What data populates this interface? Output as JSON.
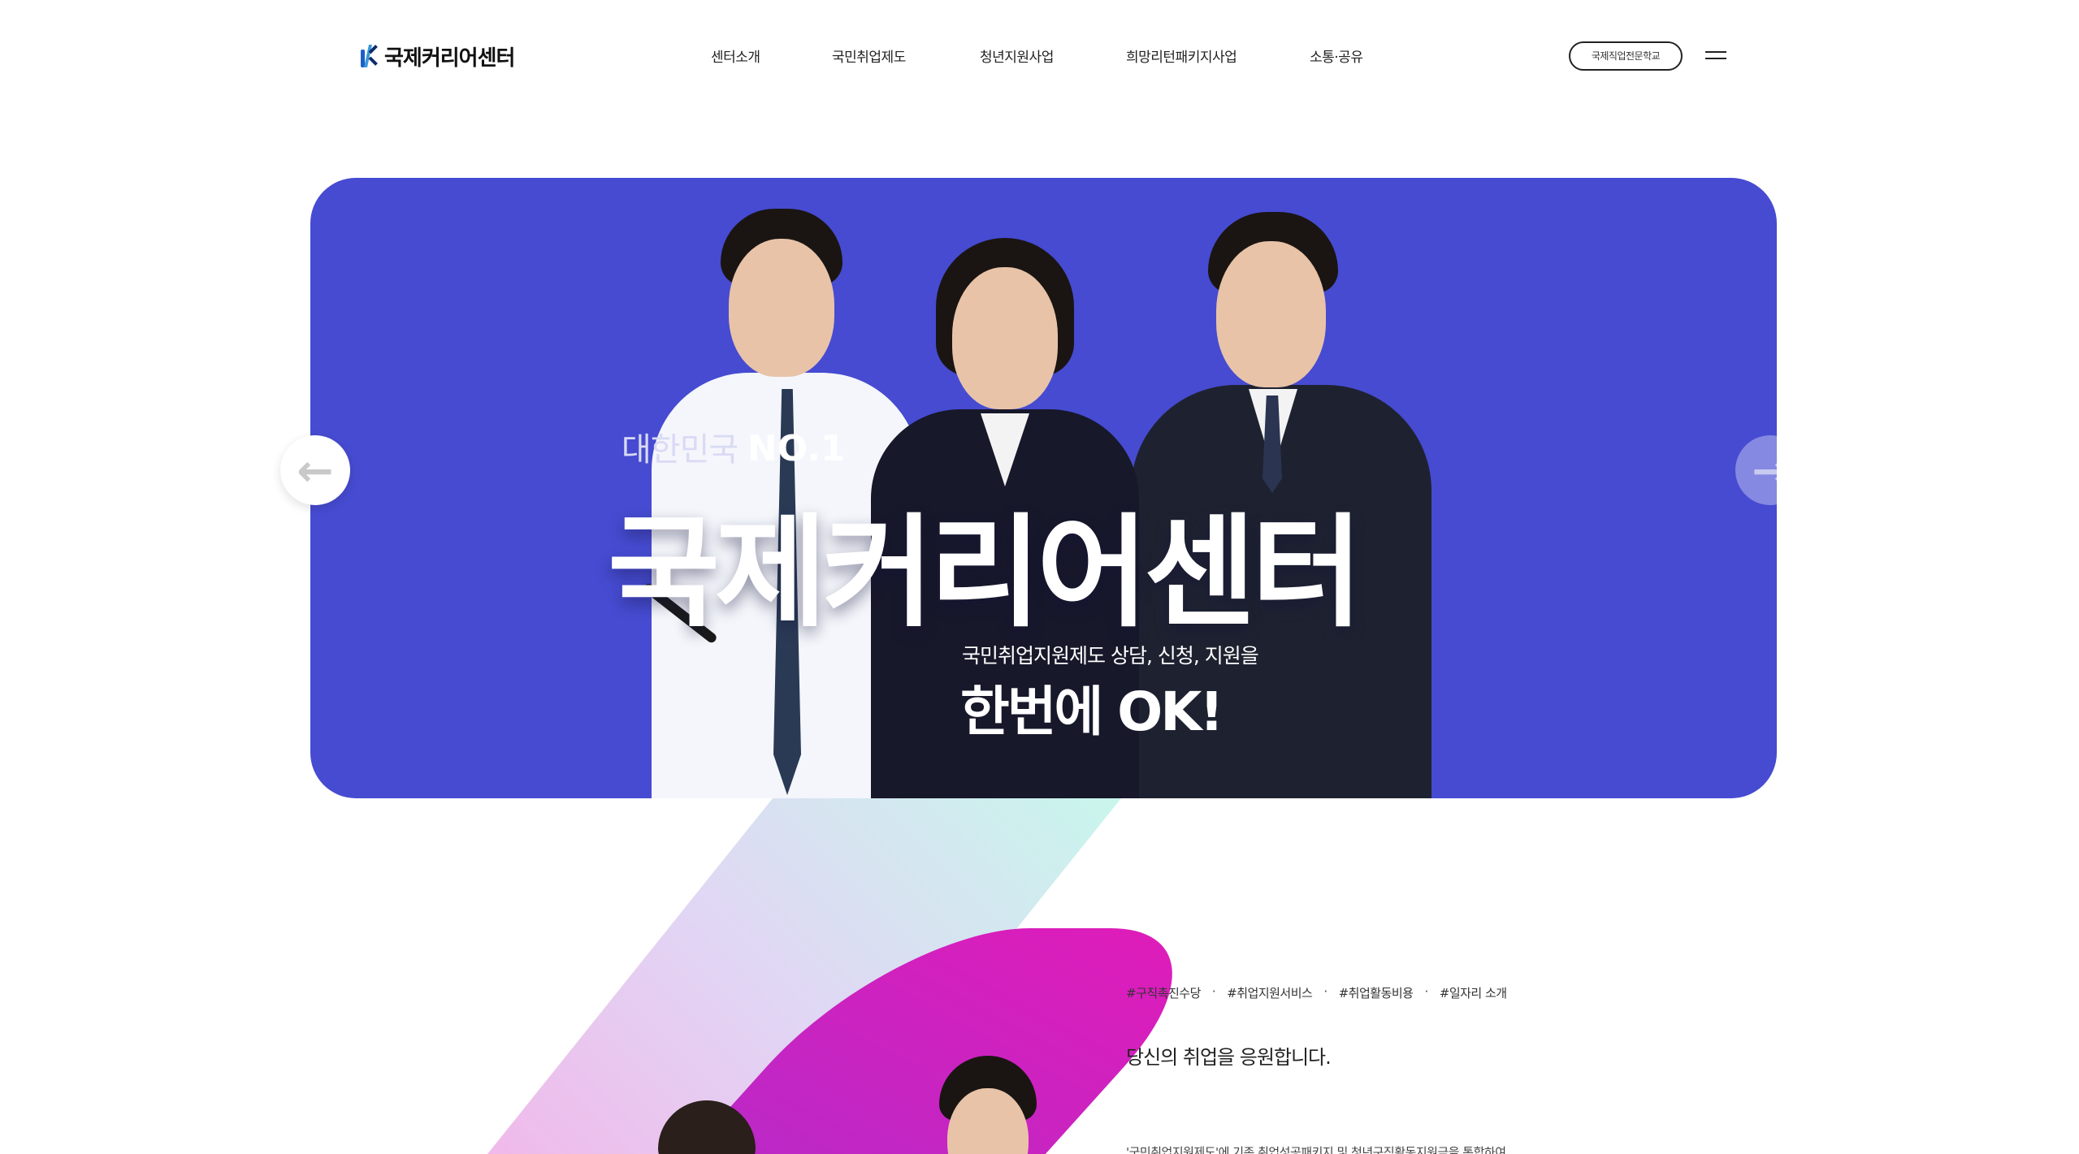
{
  "header": {
    "logo_text": "국제커리어센터",
    "nav": [
      "센터소개",
      "국민취업제도",
      "청년지원사업",
      "희망리턴패키지사업",
      "소통·공유"
    ],
    "school_button": "국제직업전문학교"
  },
  "hero": {
    "sub_prefix": "대한민국",
    "sub_badge": "NO.1",
    "title": "국제커리어센터",
    "desc": "국민취업지원제도 상담, 신청, 지원을",
    "ok": "한번에 OK!",
    "bg_color": "#464bd1",
    "prev_icon": "arrow-left-icon",
    "next_icon": "arrow-right-icon"
  },
  "section": {
    "tags": [
      "#구직촉진수당",
      "#취업지원서비스",
      "#취업활동비용",
      "#일자리 소개"
    ],
    "lead": "당신의 취업을 응원합니다.",
    "paragraph": "'국민취업지원제도'에 기존 취업성공패키지 및 청년구직활동지원금을 통합하여"
  }
}
